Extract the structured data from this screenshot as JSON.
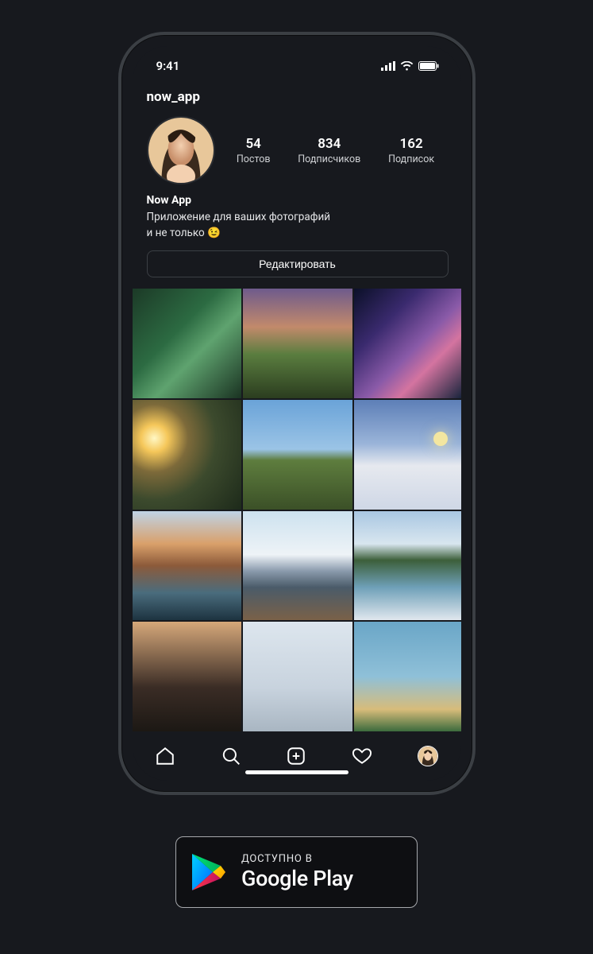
{
  "status": {
    "time": "9:41"
  },
  "profile": {
    "username": "now_app",
    "display_name": "Now App",
    "bio_line1": "Приложение для ваших фотографий",
    "bio_line2": "и не только 😉",
    "stats": {
      "posts": {
        "count": "54",
        "label": "Постов"
      },
      "followers": {
        "count": "834",
        "label": "Подписчиков"
      },
      "following": {
        "count": "162",
        "label": "Подписок"
      }
    },
    "edit_button": "Редактировать"
  },
  "tabbar": {
    "home": "home-icon",
    "search": "search-icon",
    "add": "add-post-icon",
    "activity": "heart-icon",
    "profile": "profile-avatar-icon"
  },
  "play_badge": {
    "prefix": "ДОСТУПНО В",
    "store": "Google Play"
  }
}
